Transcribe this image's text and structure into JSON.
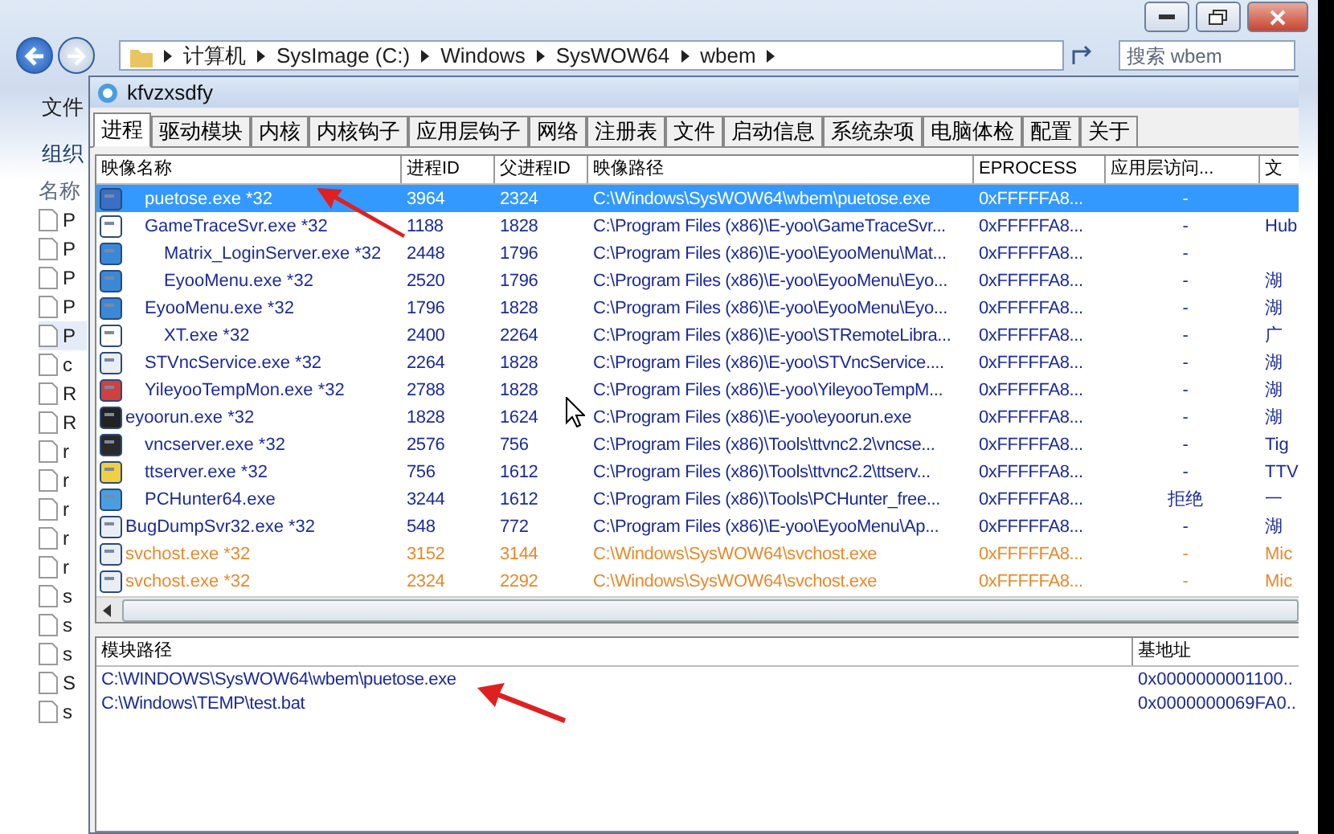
{
  "explorer": {
    "breadcrumbs": [
      "计算机",
      "SysImage (C:)",
      "Windows",
      "SysWOW64",
      "wbem"
    ],
    "search": {
      "placeholder": "搜索 wbem"
    },
    "menu": [
      "文件"
    ],
    "toolbar": [
      "组织"
    ],
    "list_header": "名称",
    "files": [
      {
        "name": "P",
        "selected": false
      },
      {
        "name": "P",
        "selected": false
      },
      {
        "name": "P",
        "selected": false
      },
      {
        "name": "P",
        "selected": false
      },
      {
        "name": "P",
        "selected": true
      },
      {
        "name": "c",
        "selected": false
      },
      {
        "name": "R",
        "selected": false
      },
      {
        "name": "R",
        "selected": false
      },
      {
        "name": "r",
        "selected": false
      },
      {
        "name": "r",
        "selected": false
      },
      {
        "name": "r",
        "selected": false
      },
      {
        "name": "r",
        "selected": false
      },
      {
        "name": "r",
        "selected": false
      },
      {
        "name": "s",
        "selected": false
      },
      {
        "name": "s",
        "selected": false
      },
      {
        "name": "s",
        "selected": false
      },
      {
        "name": "S",
        "selected": false
      },
      {
        "name": "s",
        "selected": false
      }
    ]
  },
  "window": {
    "title": "kfvzxsdfy"
  },
  "tabs": [
    {
      "label": "进程",
      "selected": true
    },
    {
      "label": "驱动模块",
      "selected": false
    },
    {
      "label": "内核",
      "selected": false
    },
    {
      "label": "内核钩子",
      "selected": false
    },
    {
      "label": "应用层钩子",
      "selected": false
    },
    {
      "label": "网络",
      "selected": false
    },
    {
      "label": "注册表",
      "selected": false
    },
    {
      "label": "文件",
      "selected": false
    },
    {
      "label": "启动信息",
      "selected": false
    },
    {
      "label": "系统杂项",
      "selected": false
    },
    {
      "label": "电脑体检",
      "selected": false
    },
    {
      "label": "配置",
      "selected": false
    },
    {
      "label": "关于",
      "selected": false
    }
  ],
  "process_table": {
    "columns": [
      "映像名称",
      "进程ID",
      "父进程ID",
      "映像路径",
      "EPROCESS",
      "应用层访问...",
      "文"
    ],
    "rows": [
      {
        "kind": "child",
        "name": "puetose.exe *32",
        "pid": "3964",
        "ppid": "2324",
        "path": "C:\\Windows\\SysWOW64\\wbem\\puetose.exe",
        "eprocess": "0xFFFFFA8...",
        "access": "-",
        "selected": true
      },
      {
        "kind": "child",
        "name": "GameTraceSvr.exe *32",
        "pid": "1188",
        "ppid": "1828",
        "path": "C:\\Program Files (x86)\\E-yoo\\GameTraceSvr...",
        "eprocess": "0xFFFFFA8...",
        "access": "-",
        "file": "Hub",
        "color": "#1a2a9a",
        "selected": false,
        "children": [
          {
            "kind": "child",
            "name": "Matrix_LoginServer.exe *32",
            "pid": "2448",
            "ppid": "1796",
            "path": "C:\\Program Files (x86)\\E-yoo\\EyooMenu\\Mat...",
            "eprocess": "0xFFFFFA8...",
            "access": "-",
            "color": "#1a2a9a",
            "selected": false
          },
          {
            "kind": "child",
            "name": "EyooMenu.exe *32",
            "pid": "2520",
            "ppid": "1796",
            "path": "C:\\Program Files (x86)\\E-yoo\\EyooMenu\\Eyo...",
            "eprocess": "0xFFFFFA8...",
            "access": "-",
            "file": "湖",
            "color": "#1a2a9a",
            "selected": false
          }
        ]
      },
      {
        "kind": "child",
        "name": "EyooMenu.exe *32",
        "pid": "1796",
        "ppid": "1828",
        "path": "C:\\Program Files (x86)\\E-yoo\\EyooMenu\\Eyo...",
        "eprocess": "0xFFFFFA8...",
        "access": "-",
        "file": "湖",
        "color": "#1a2a9a",
        "selected": false,
        "children": [
          {
            "kind": "child",
            "name": "XT.exe *32",
            "pid": "2400",
            "ppid": "2264",
            "path": "C:\\Program Files (x86)\\E-yoo\\STRemoteLibra...",
            "eprocess": "0xFFFFFA8...",
            "access": "-",
            "file": "广",
            "color": "#1a2a9a",
            "selected": false
          }
        ]
      },
      {
        "kind": "child",
        "name": "STVncService.exe *32",
        "pid": "2264",
        "ppid": "1828",
        "path": "C:\\Program Files (x86)\\E-yoo\\STVncService....",
        "eprocess": "0xFFFFFA8...",
        "access": "-",
        "file": "湖",
        "color": "#1a2a9a",
        "selected": false
      },
      {
        "kind": "child",
        "name": "YileyooTempMon.exe *32",
        "pid": "2788",
        "ppid": "1828",
        "path": "C:\\Program Files (x86)\\E-yoo\\YileyooTempM...",
        "eprocess": "0xFFFFFA8...",
        "access": "-",
        "file": "湖",
        "color": "#1a2a9a",
        "selected": false
      },
      {
        "kind": "root",
        "name": "eyoorun.exe *32",
        "pid": "1828",
        "ppid": "1624",
        "path": "C:\\Program Files (x86)\\E-yoo\\eyoorun.exe",
        "eprocess": "0xFFFFFA8...",
        "access": "-",
        "file": "湖",
        "color": "#1a2a9a",
        "selected": false,
        "children": [
          {
            "kind": "child",
            "name": "vncserver.exe *32",
            "pid": "2576",
            "ppid": "756",
            "path": "C:\\Program Files (x86)\\Tools\\ttvnc2.2\\vncse...",
            "eprocess": "0xFFFFFA8...",
            "access": "-",
            "file": "Tig",
            "color": "#1a2a9a",
            "selected": false
          }
        ]
      },
      {
        "kind": "child",
        "name": "ttserver.exe *32",
        "pid": "756",
        "ppid": "1612",
        "path": "C:\\Program Files (x86)\\Tools\\ttvnc2.2\\ttserv...",
        "eprocess": "0xFFFFFA8...",
        "access": "-",
        "file": "TTV",
        "color": "#1a2a9a",
        "selected": false
      },
      {
        "kind": "child",
        "name": "PCHunter64.exe",
        "pid": "3244",
        "ppid": "1612",
        "path": "C:\\Program Files (x86)\\Tools\\PCHunter_free...",
        "eprocess": "0xFFFFFA8...",
        "access": "拒绝",
        "file": "一",
        "color": "#1a2a9a",
        "selected": false
      },
      {
        "kind": "root",
        "name": "BugDumpSvr32.exe *32",
        "pid": "548",
        "ppid": "772",
        "path": "C:\\Program Files (x86)\\E-yoo\\EyooMenu\\Ap...",
        "eprocess": "0xFFFFFA8...",
        "access": "-",
        "file": "湖",
        "color": "#1a2a9a",
        "selected": false
      },
      {
        "kind": "root",
        "name": "svchost.exe *32",
        "pid": "3152",
        "ppid": "3144",
        "path": "C:\\Windows\\SysWOW64\\svchost.exe",
        "eprocess": "0xFFFFFA8...",
        "access": "-",
        "file": "Mic",
        "color": "#e8892a",
        "selected": false
      },
      {
        "kind": "root",
        "name": "svchost.exe *32",
        "pid": "2324",
        "ppid": "2292",
        "path": "C:\\Windows\\SysWOW64\\svchost.exe",
        "eprocess": "0xFFFFFA8...",
        "access": "-",
        "file": "Mic",
        "color": "#e8892a",
        "selected": false
      }
    ]
  },
  "module_table": {
    "columns": [
      "模块路径",
      "基地址"
    ],
    "rows": [
      {
        "path": "C:\\WINDOWS\\SysWOW64\\wbem\\puetose.exe",
        "base": "0x0000000001100.."
      },
      {
        "path": "C:\\Windows\\TEMP\\test.bat",
        "base": "0x0000000069FA0.."
      }
    ]
  }
}
